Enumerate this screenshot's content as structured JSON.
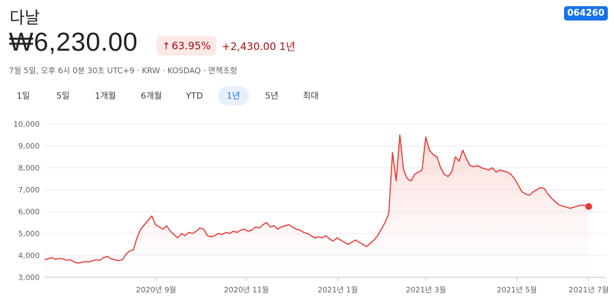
{
  "header": {
    "title": "다날",
    "ticker": "064260"
  },
  "price": {
    "value": "₩6,230.00",
    "change_percent": "63.95%",
    "change_arrow": "↑",
    "change_amount": "+2,430.00 1년"
  },
  "meta": "7월 5일, 오후 6시 0분 30초 UTC+9 · KRW · KOSDAQ · 면책조항",
  "tabs": [
    "1일",
    "5일",
    "1개월",
    "6개월",
    "YTD",
    "1년",
    "5년",
    "최대"
  ],
  "active_tab": "1년",
  "colors": {
    "line": "#e53935",
    "fill": "#fce8e6",
    "accent": "#1a73e8",
    "negative_text": "#a50e0e"
  },
  "chart_data": {
    "type": "area",
    "title": "",
    "ylim": [
      3000,
      10000
    ],
    "y_ticks": [
      "10,000",
      "9,000",
      "8,000",
      "7,000",
      "6,000",
      "5,000",
      "4,000",
      "3,000"
    ],
    "y_tick_values": [
      10000,
      9000,
      8000,
      7000,
      6000,
      5000,
      4000,
      3000
    ],
    "x_ticks": [
      {
        "label": "2020년 9월",
        "t": 0.205
      },
      {
        "label": "2020년 11월",
        "t": 0.371
      },
      {
        "label": "2021년 1월",
        "t": 0.539
      },
      {
        "label": "2021년 3월",
        "t": 0.701
      },
      {
        "label": "2021년 5월",
        "t": 0.868
      },
      {
        "label": "2021년 7월",
        "t": 1.0
      }
    ],
    "grid": true,
    "series": [
      {
        "values": [
          3800,
          3850,
          3900,
          3820,
          3860,
          3840,
          3780,
          3800,
          3700,
          3650,
          3680,
          3720,
          3700,
          3750,
          3800,
          3780,
          3900,
          3950,
          3850,
          3800,
          3760,
          3800,
          4050,
          4200,
          4250,
          4800,
          5200,
          5400,
          5600,
          5800,
          5400,
          5300,
          5200,
          5350,
          5100,
          4950,
          4800,
          5000,
          4900,
          5050,
          5000,
          5100,
          5250,
          5200,
          4900,
          4850,
          4900,
          5000,
          4950,
          5050,
          5000,
          5100,
          5050,
          5150,
          5200,
          5100,
          5150,
          5300,
          5250,
          5400,
          5500,
          5300,
          5350,
          5200,
          5300,
          5350,
          5400,
          5300,
          5200,
          5150,
          5050,
          5000,
          4900,
          4800,
          4850,
          4800,
          4900,
          4750,
          4650,
          4800,
          4700,
          4600,
          4500,
          4600,
          4700,
          4600,
          4500,
          4400,
          4550,
          4700,
          4900,
          5200,
          5500,
          5900,
          8700,
          7400,
          9500,
          7900,
          7500,
          7400,
          7700,
          7800,
          7900,
          9400,
          8800,
          8600,
          8500,
          8000,
          7700,
          7600,
          7800,
          8500,
          8300,
          8800,
          8400,
          8100,
          8050,
          8100,
          8000,
          7950,
          7900,
          8000,
          7800,
          7900,
          7850,
          7800,
          7700,
          7500,
          7200,
          6900,
          6800,
          6750,
          6900,
          7000,
          7100,
          7050,
          6800,
          6600,
          6450,
          6300,
          6250,
          6200,
          6150,
          6200,
          6250,
          6300,
          6280,
          6230
        ]
      }
    ]
  }
}
